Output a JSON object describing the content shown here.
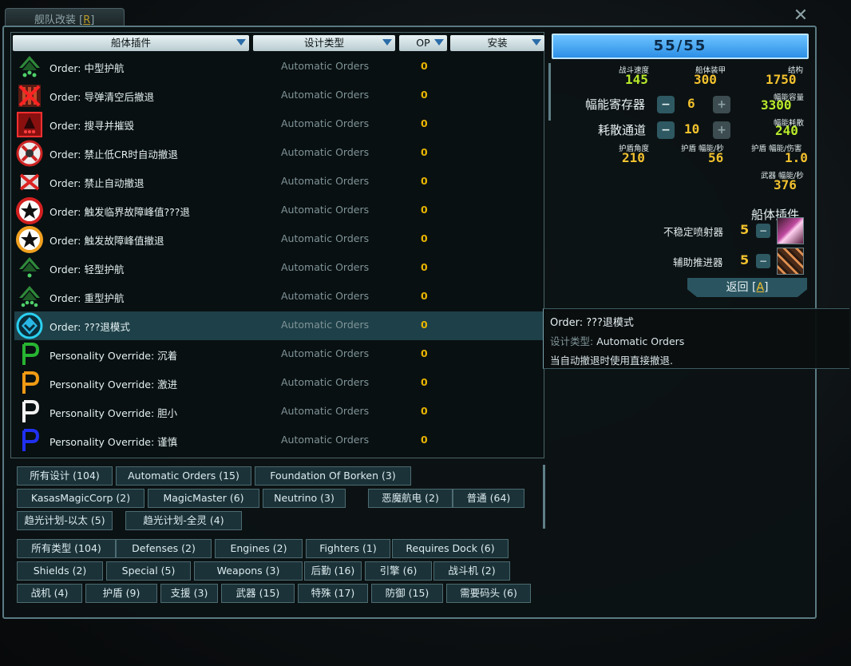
{
  "window": {
    "title_prefix": "舰队改装 [",
    "title_hotkey": "R",
    "title_suffix": "]",
    "close_glyph": "✕"
  },
  "columns": {
    "hullmods": "船体插件",
    "design_type": "设计类型",
    "op": "OP",
    "install": "安装"
  },
  "rows": [
    {
      "name": "Order: 中型护航",
      "type": "Automatic Orders",
      "op": "0",
      "icon": "escort-medium-icon"
    },
    {
      "name": "Order: 导弹清空后撤退",
      "type": "Automatic Orders",
      "op": "0",
      "icon": "missile-retreat-icon"
    },
    {
      "name": "Order: 搜寻并摧毁",
      "type": "Automatic Orders",
      "op": "0",
      "icon": "search-destroy-icon"
    },
    {
      "name": "Order: 禁止低CR时自动撤退",
      "type": "Automatic Orders",
      "op": "0",
      "icon": "no-low-cr-retreat-icon"
    },
    {
      "name": "Order: 禁止自动撤退",
      "type": "Automatic Orders",
      "op": "0",
      "icon": "no-auto-retreat-icon"
    },
    {
      "name": "Order: 触发临界故障峰值???退",
      "type": "Automatic Orders",
      "op": "0",
      "icon": "star-red-ring-icon"
    },
    {
      "name": "Order: 触发故障峰值撤退",
      "type": "Automatic Orders",
      "op": "0",
      "icon": "star-orange-ring-icon"
    },
    {
      "name": "Order: 轻型护航",
      "type": "Automatic Orders",
      "op": "0",
      "icon": "escort-light-icon"
    },
    {
      "name": "Order: 重型护航",
      "type": "Automatic Orders",
      "op": "0",
      "icon": "escort-heavy-icon"
    },
    {
      "name": "Order: ???退模式",
      "type": "Automatic Orders",
      "op": "0",
      "icon": "retreat-mode-icon"
    },
    {
      "name": "Personality Override: 沉着",
      "type": "Automatic Orders",
      "op": "0",
      "icon": "personality-green-icon"
    },
    {
      "name": "Personality Override: 激进",
      "type": "Automatic Orders",
      "op": "0",
      "icon": "personality-orange-icon"
    },
    {
      "name": "Personality Override: 胆小",
      "type": "Automatic Orders",
      "op": "0",
      "icon": "personality-white-icon"
    },
    {
      "name": "Personality Override: 谨慎",
      "type": "Automatic Orders",
      "op": "0",
      "icon": "personality-blue-icon"
    }
  ],
  "filters_design": [
    "所有设计 (104)",
    "Automatic Orders (15)",
    "Foundation Of Borken (3)",
    "KasasMagicCorp (2)",
    "MagicMaster (6)",
    "Neutrino (3)",
    "恶魔航电 (2)",
    "普通 (64)",
    "趋光计划-以太 (5)",
    "趋光计划-全灵 (4)"
  ],
  "filters_type": [
    "所有类型 (104)",
    "Defenses (2)",
    "Engines (2)",
    "Fighters (1)",
    "Requires Dock (6)",
    "Shields (2)",
    "Special (5)",
    "Weapons (3)",
    "后勤 (16)",
    "引擎 (6)",
    "战斗机 (2)",
    "战机 (4)",
    "护盾 (9)",
    "支援 (3)",
    "武器 (15)",
    "特殊 (17)",
    "防御 (15)",
    "需要码头 (6)"
  ],
  "ship": {
    "op_bar": "55/55",
    "speed_label": "战斗速度",
    "speed": "145",
    "armor_label": "船体装甲",
    "armor": "300",
    "hull_label": "结构",
    "hull": "1750",
    "caps_label": "幅能寄存器",
    "caps": "6",
    "flux_cap_label": "幅能容量",
    "flux_cap": "3300",
    "vents_label": "耗散通道",
    "vents": "10",
    "dissipation_label": "幅能耗散",
    "dissipation": "240",
    "shield_arc_label": "护盾角度",
    "shield_arc": "210",
    "shield_upkeep_label": "护盾 幅能/秒",
    "shield_upkeep": "56",
    "shield_eff_label": "护盾 幅能/伤害",
    "shield_eff": "1.0",
    "weapon_flux_label": "武器 幅能/秒",
    "weapon_flux": "376",
    "minus": "−",
    "plus": "+"
  },
  "installed": {
    "title": "船体插件",
    "items": [
      {
        "name": "不稳定喷射器",
        "op": "5",
        "remove": "−"
      },
      {
        "name": "辅助推进器",
        "op": "5",
        "remove": "−"
      }
    ]
  },
  "back": {
    "prefix": "返回 [",
    "hotkey": "A",
    "suffix": "]"
  },
  "tooltip": {
    "title": "Order: ???退模式",
    "type_label": "设计类型: ",
    "type_value": "Automatic Orders",
    "desc": "当自动撤退时使用直接撤退."
  }
}
